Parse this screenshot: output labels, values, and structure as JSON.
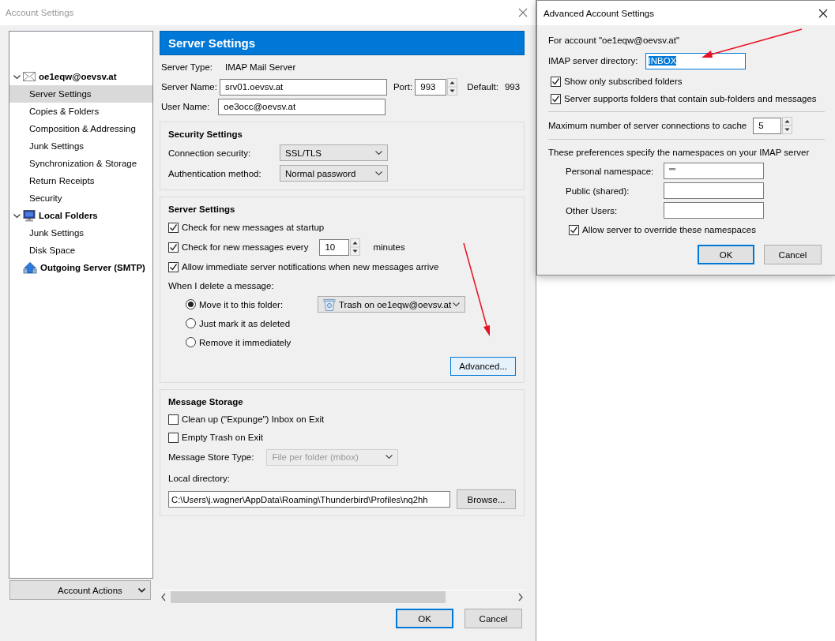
{
  "window": {
    "title": "Account Settings"
  },
  "sidebar": {
    "accounts": [
      {
        "label": "oe1eqw@oevsv.at",
        "kind": "mail",
        "expanded": true,
        "children": [
          {
            "label": "Server Settings",
            "selected": true
          },
          {
            "label": "Copies & Folders",
            "selected": false
          },
          {
            "label": "Composition & Addressing",
            "selected": false
          },
          {
            "label": "Junk Settings",
            "selected": false
          },
          {
            "label": "Synchronization & Storage",
            "selected": false
          },
          {
            "label": "Return Receipts",
            "selected": false
          },
          {
            "label": "Security",
            "selected": false
          }
        ]
      },
      {
        "label": "Local Folders",
        "kind": "local",
        "expanded": true,
        "children": [
          {
            "label": "Junk Settings",
            "selected": false
          },
          {
            "label": "Disk Space",
            "selected": false
          }
        ]
      },
      {
        "label": "Outgoing Server (SMTP)",
        "kind": "smtp"
      }
    ]
  },
  "account_actions": "Account Actions",
  "panel": {
    "title": "Server Settings",
    "server_type_label": "Server Type:",
    "server_type": "IMAP Mail Server",
    "server_name_label": "Server Name:",
    "server_name": "srv01.oevsv.at",
    "port_label": "Port:",
    "port": "993",
    "default_label": "Default:",
    "default_port": "993",
    "user_name_label": "User Name:",
    "user_name": "oe3occ@oevsv.at"
  },
  "security": {
    "title": "Security Settings",
    "fields": [
      {
        "label": "Connection security:",
        "value": "SSL/TLS"
      },
      {
        "label": "Authentication method:",
        "value": "Normal password"
      }
    ]
  },
  "server_settings": {
    "title": "Server Settings",
    "checks": [
      {
        "label": "Check for new messages at startup",
        "checked": true
      },
      {
        "label": "Check for new messages every",
        "checked": true,
        "value": "10",
        "suffix": "minutes"
      },
      {
        "label": "Allow immediate server notifications when new messages arrive",
        "checked": true
      }
    ],
    "delete_label": "When I delete a message:",
    "delete_options": [
      {
        "label": "Move it to this folder:",
        "selected": true,
        "folder": "Trash on oe1eqw@oevsv.at"
      },
      {
        "label": "Just mark it as deleted",
        "selected": false
      },
      {
        "label": "Remove it immediately",
        "selected": false
      }
    ],
    "advanced_button": {
      "label": "Advanced...",
      "focused": true
    }
  },
  "message_storage": {
    "title": "Message Storage",
    "checks": [
      {
        "label": "Clean up (\"Expunge\") Inbox on Exit",
        "checked": false
      },
      {
        "label": "Empty Trash on Exit",
        "checked": false
      }
    ],
    "store_type_label": "Message Store Type:",
    "store_type": "File per folder (mbox)",
    "store_type_disabled": true,
    "local_directory_label": "Local directory:",
    "local_directory": "C:\\Users\\j.wagner\\AppData\\Roaming\\Thunderbird\\Profiles\\nq2hh",
    "browse_button": "Browse..."
  },
  "buttons": [
    {
      "label": "OK",
      "default": true
    },
    {
      "label": "Cancel",
      "default": false
    }
  ],
  "dialog": {
    "title": "Advanced Account Settings",
    "account_note": "For account \"oe1eqw@oevsv.at\"",
    "directory_label": "IMAP server directory:",
    "directory": "INBOX",
    "directory_selected": true,
    "checks": [
      {
        "label": "Show only subscribed folders",
        "checked": true
      },
      {
        "label": "Server supports folders that contain sub-folders and messages",
        "checked": true
      }
    ],
    "cache_label": "Maximum number of server connections to cache",
    "cache": "5",
    "namespaces_note": "These preferences specify the namespaces on your IMAP server",
    "namespaces": [
      {
        "label": "Personal namespace:",
        "value": "\"\""
      },
      {
        "label": "Public (shared):"
      },
      {
        "label": "Other Users:"
      }
    ],
    "override": {
      "label": "Allow server to override these namespaces",
      "checked": true
    },
    "buttons": [
      {
        "label": "OK",
        "default": true
      },
      {
        "label": "Cancel",
        "default": false
      }
    ]
  }
}
